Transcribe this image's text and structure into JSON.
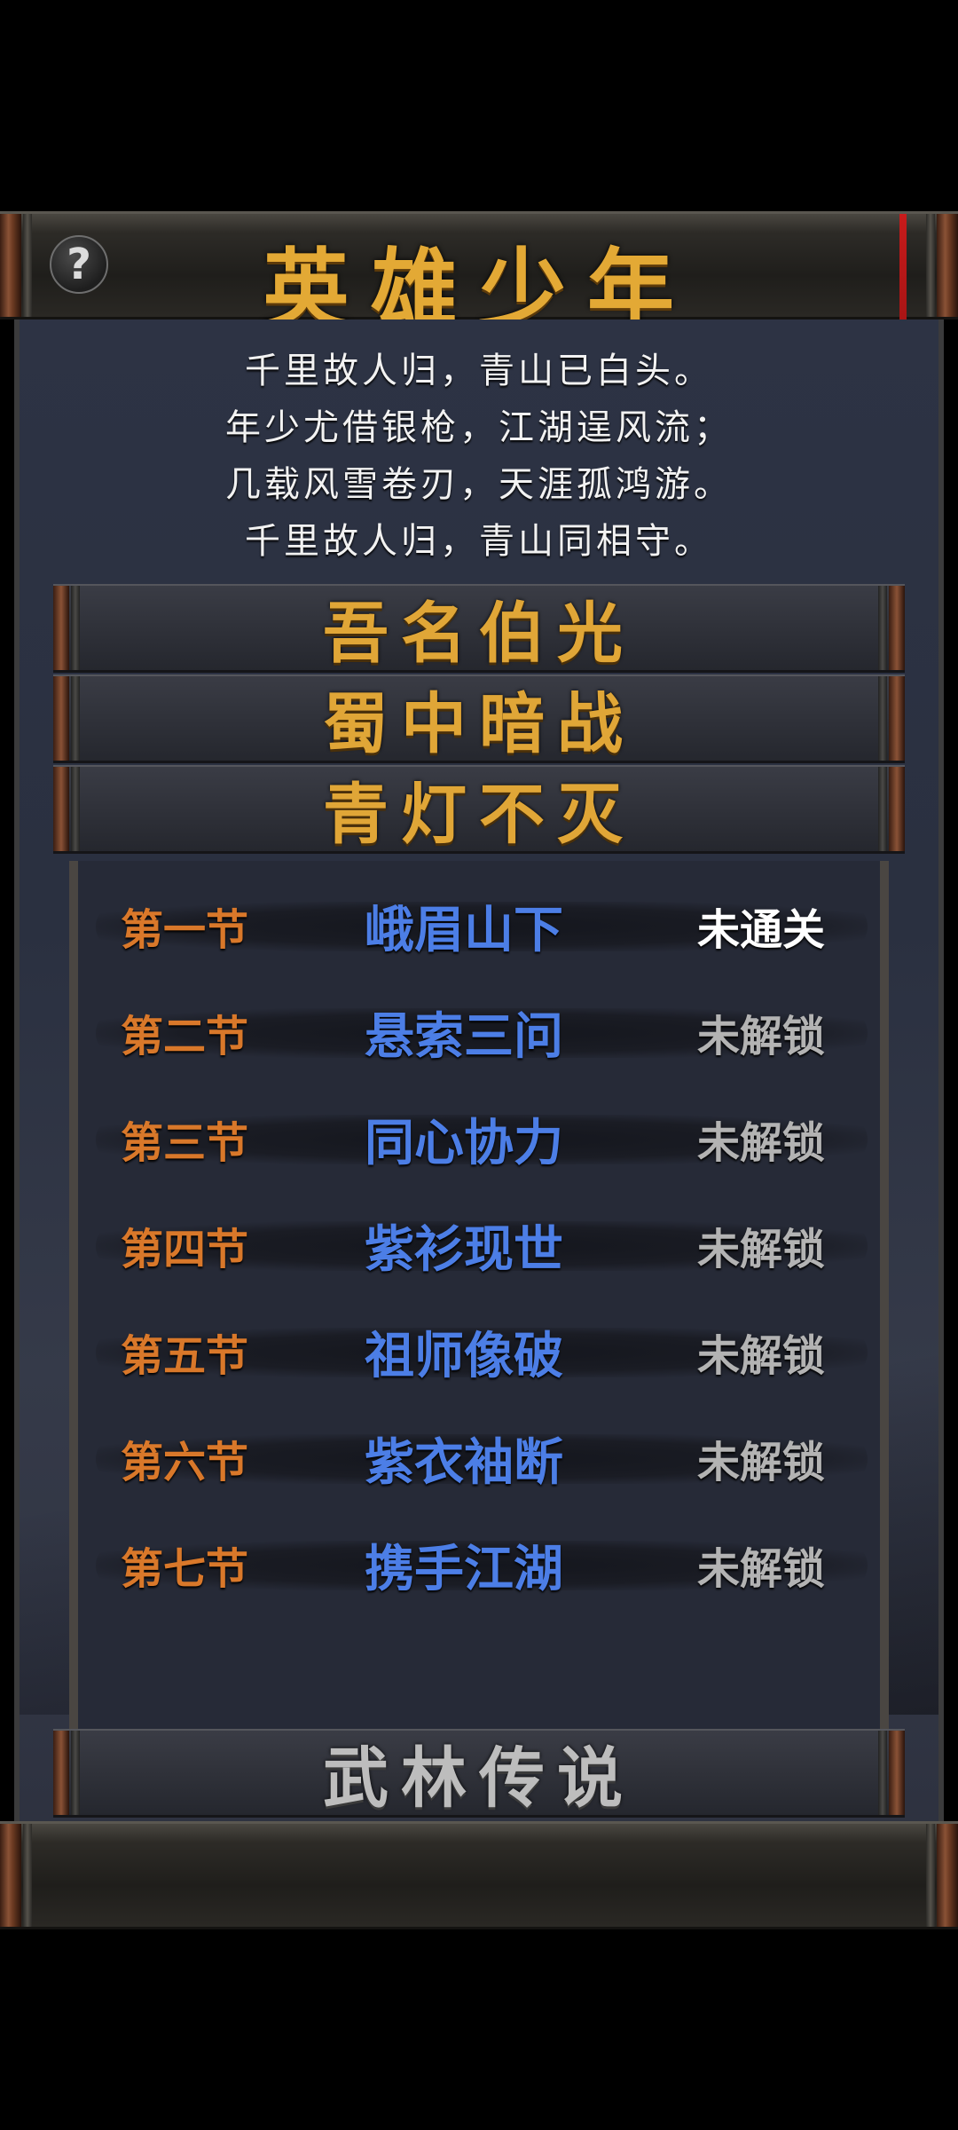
{
  "header": {
    "title": "英雄少年",
    "help_icon": "question-mark-icon",
    "help_glyph": "?"
  },
  "poem": [
    "千里故人归，青山已白头。",
    "年少尤借银枪，江湖逞风流；",
    "几载风雪卷刃，天涯孤鸿游。",
    "千里故人归，青山同相守。"
  ],
  "chapters": [
    {
      "label": "吾名伯光"
    },
    {
      "label": "蜀中暗战"
    },
    {
      "label": "青灯不灭"
    },
    {
      "label": "武林传说"
    }
  ],
  "sections": [
    {
      "num": "第一节",
      "name": "峨眉山下",
      "status": "未通关"
    },
    {
      "num": "第二节",
      "name": "悬索三问",
      "status": "未解锁"
    },
    {
      "num": "第三节",
      "name": "同心协力",
      "status": "未解锁"
    },
    {
      "num": "第四节",
      "name": "紫衫现世",
      "status": "未解锁"
    },
    {
      "num": "第五节",
      "name": "祖师像破",
      "status": "未解锁"
    },
    {
      "num": "第六节",
      "name": "紫衣袖断",
      "status": "未解锁"
    },
    {
      "num": "第七节",
      "name": "携手江湖",
      "status": "未解锁"
    }
  ],
  "colors": {
    "title_gold": "#e3a935",
    "section_number": "#d9782a",
    "section_name": "#4c7ee6",
    "status_locked": "#b3b3b3",
    "status_open": "#ffffff",
    "ribbon_red": "#c81b1b"
  }
}
